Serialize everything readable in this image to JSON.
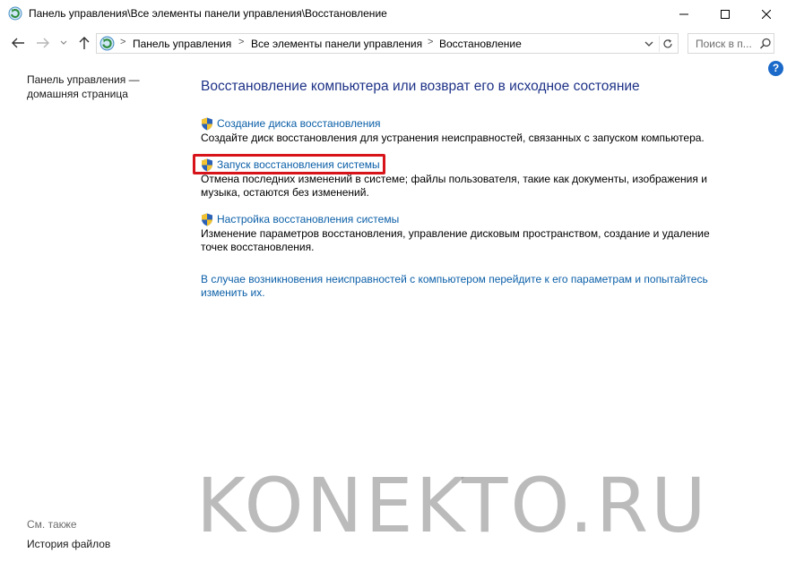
{
  "window": {
    "title": "Панель управления\\Все элементы панели управления\\Восстановление"
  },
  "address": {
    "segments": [
      "Панель управления",
      "Все элементы панели управления",
      "Восстановление"
    ],
    "separator": ">"
  },
  "search": {
    "placeholder": "Поиск в п..."
  },
  "sidebar": {
    "home_line1": "Панель управления —",
    "home_line2": "домашняя страница",
    "see_also": "См. также",
    "file_history": "История файлов"
  },
  "main": {
    "title": "Восстановление компьютера или возврат его в исходное состояние",
    "tasks": [
      {
        "link": "Создание диска восстановления",
        "desc_line1": "Создайте диск восстановления для устранения неисправностей, связанных с запуском компьютера.",
        "desc_line2": ""
      },
      {
        "link": "Запуск восстановления системы",
        "desc_line1": "Отмена последних изменений в системе; файлы пользователя, такие как документы, изображения и",
        "desc_line2": "музыка, остаются без изменений."
      },
      {
        "link": "Настройка восстановления системы",
        "desc_line1": "Изменение параметров восстановления, управление дисковым пространством, создание и удаление",
        "desc_line2": "точек восстановления."
      }
    ],
    "troubleshoot_line1": "В случае возникновения неисправностей с компьютером перейдите к его параметрам и попытайтесь",
    "troubleshoot_line2": "изменить их."
  },
  "watermark": "KONEKTO.RU",
  "colors": {
    "link": "#0b5fa8",
    "title": "#1e3287",
    "highlight": "#d8141b",
    "help": "#1b6ac9"
  }
}
